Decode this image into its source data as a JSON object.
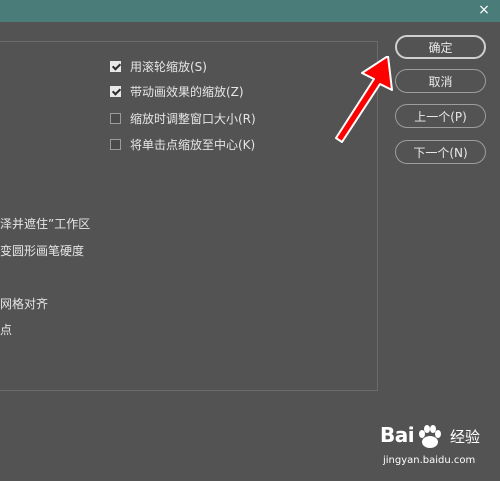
{
  "dialog": {
    "close_glyph": "×"
  },
  "options": {
    "checkboxes": [
      {
        "label": "用滚轮缩放(S)",
        "checked": true
      },
      {
        "label": "带动画效果的缩放(Z)",
        "checked": true
      },
      {
        "label": "缩放时调整窗口大小(R)",
        "checked": false
      },
      {
        "label": "将单击点缩放至中心(K)",
        "checked": false
      }
    ],
    "clipped_texts": [
      "泽并遮住”工作区",
      "变圆形画笔硬度",
      "网格对齐",
      "点"
    ]
  },
  "buttons": {
    "ok": "确定",
    "cancel": "取消",
    "prev": "上一个(P)",
    "next": "下一个(N)"
  },
  "watermark": {
    "logo_left": "Bai",
    "logo_right": "经验",
    "url": "jingyan.baidu.com"
  },
  "colors": {
    "background": "#535353",
    "titlebar": "#4a7c7a",
    "annotation_arrow": "#ff0000"
  }
}
